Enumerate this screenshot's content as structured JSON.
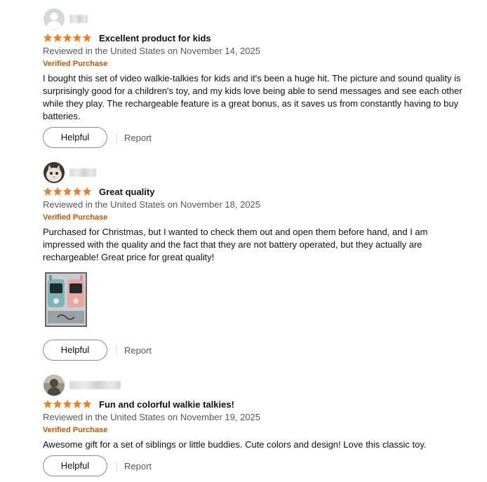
{
  "reviews": [
    {
      "avatar": "default-avatar-icon",
      "title": "Excellent product for kids",
      "rating": 5,
      "meta": "Reviewed in the United States on November 14, 2025",
      "verified": "Verified Purchase",
      "body": "I bought this set of video walkie-talkies for kids and it's been a huge hit. The picture and sound quality is surprisingly good for a children's toy, and my kids love being able to send messages and see each other while they play. The rechargeable feature is a great bonus, as it saves us from constantly having to buy batteries.",
      "helpful": "Helpful",
      "report": "Report"
    },
    {
      "avatar": "cat-photo-avatar",
      "title": "Great quality",
      "rating": 5,
      "meta": "Reviewed in the United States on November 18, 2025",
      "verified": "Verified Purchase",
      "body": "Purchased for Christmas, but I wanted to check them out and open them before hand, and I am impressed with the quality and the fact that they are not battery operated, but they actually are rechargeable! Great price for great quality!",
      "image": "walkie-talkies-in-box-photo",
      "helpful": "Helpful",
      "report": "Report"
    },
    {
      "avatar": "person-photo-avatar",
      "title": "Fun and colorful walkie talkies!",
      "rating": 5,
      "meta": "Reviewed in the United States on November 19, 2025",
      "verified": "Verified Purchase",
      "body": "Awesome gift for a set of siblings or little buddies. Cute colors and design! Love this classic toy.",
      "helpful": "Helpful",
      "report": "Report"
    }
  ],
  "colors": {
    "star": "#f17e1e",
    "verified": "#c45500",
    "meta": "#565959",
    "text": "#0f1111"
  }
}
